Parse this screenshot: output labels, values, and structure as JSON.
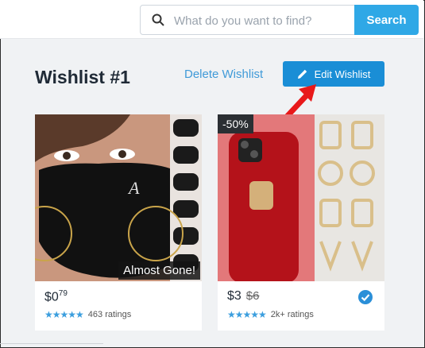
{
  "search": {
    "placeholder": "What do you want to find?",
    "button_label": "Search"
  },
  "wishlist": {
    "title": "Wishlist #1",
    "delete_label": "Delete Wishlist",
    "edit_label": "Edit Wishlist"
  },
  "products": [
    {
      "badge": "Almost Gone!",
      "price_main": "$0",
      "price_cents": "79",
      "old_price": "",
      "rating_stars": 4.5,
      "ratings_text": "463 ratings"
    },
    {
      "badge": "-50%",
      "price_main": "$3",
      "price_cents": "",
      "old_price": "$6",
      "rating_stars": 4.5,
      "ratings_text": "2k+ ratings"
    }
  ],
  "colors": {
    "accent": "#1a8ed6",
    "search_button": "#2fa8e6",
    "star": "#3b9ede",
    "arrow": "#e8191a"
  }
}
